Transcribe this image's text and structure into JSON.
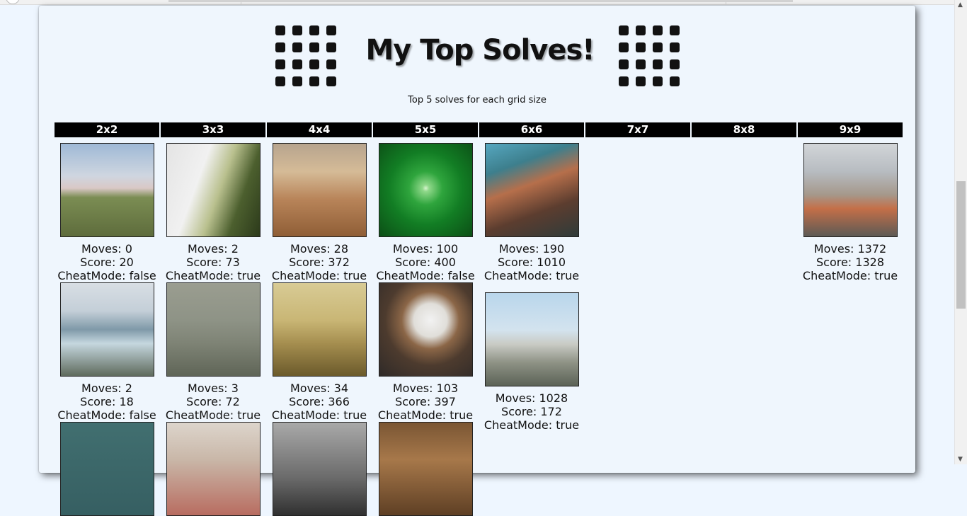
{
  "header": {
    "title": "My Top Solves!",
    "subtitle": "Top 5 solves for each grid size"
  },
  "grid_sizes": [
    "2x2",
    "3x3",
    "4x4",
    "5x5",
    "6x6",
    "7x7",
    "8x8",
    "9x9"
  ],
  "labels": {
    "moves": "Moves: ",
    "score": "Score: ",
    "cheat": "CheatMode: "
  },
  "solves": {
    "2x2": [
      {
        "image": "meadow-photo",
        "moves": "0",
        "score": "20",
        "cheat_mode": "false"
      },
      {
        "image": "waterfall-photo",
        "moves": "2",
        "score": "18",
        "cheat_mode": "false"
      },
      {
        "image": "bird-photo",
        "moves": "",
        "score": "",
        "cheat_mode": ""
      }
    ],
    "3x3": [
      {
        "image": "cliff-fog-photo",
        "moves": "2",
        "score": "73",
        "cheat_mode": "true"
      },
      {
        "image": "foggy-beach-photo",
        "moves": "3",
        "score": "72",
        "cheat_mode": "true"
      },
      {
        "image": "street-photo",
        "moves": "",
        "score": "",
        "cheat_mode": ""
      }
    ],
    "4x4": [
      {
        "image": "table-phone-photo",
        "moves": "28",
        "score": "372",
        "cheat_mode": "true"
      },
      {
        "image": "hazy-city-photo",
        "moves": "34",
        "score": "366",
        "cheat_mode": "true"
      },
      {
        "image": "bw-photo",
        "moves": "",
        "score": "",
        "cheat_mode": ""
      }
    ],
    "5x5": [
      {
        "image": "leaf-drop-photo",
        "moves": "100",
        "score": "400",
        "cheat_mode": "false"
      },
      {
        "image": "bulldog-photo",
        "moves": "103",
        "score": "397",
        "cheat_mode": "true"
      },
      {
        "image": "wood-photo",
        "moves": "",
        "score": "",
        "cheat_mode": ""
      }
    ],
    "6x6": [
      {
        "image": "cliff-town-photo",
        "moves": "190",
        "score": "1010",
        "cheat_mode": "true"
      },
      {
        "image": "industry-photo",
        "moves": "1028",
        "score": "172",
        "cheat_mode": "true"
      }
    ],
    "7x7": [],
    "8x8": [],
    "9x9": [
      {
        "image": "city-skyline-photo",
        "moves": "1372",
        "score": "1328",
        "cheat_mode": "true"
      }
    ]
  }
}
